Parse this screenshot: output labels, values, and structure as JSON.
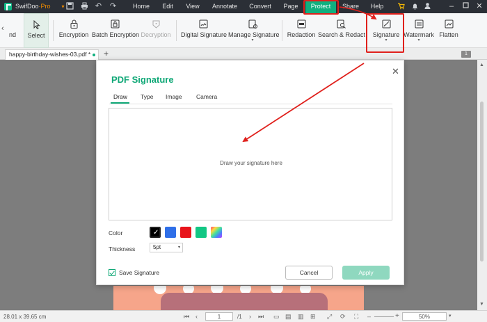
{
  "app": {
    "name": "SwifDoo",
    "edition": "·Pro",
    "brand_color": "#10b07f"
  },
  "menu": {
    "items": [
      {
        "label": "Home"
      },
      {
        "label": "Edit"
      },
      {
        "label": "View"
      },
      {
        "label": "Annotate"
      },
      {
        "label": "Convert"
      },
      {
        "label": "Page"
      },
      {
        "label": "Protect",
        "active": true
      },
      {
        "label": "Share"
      },
      {
        "label": "Help"
      }
    ]
  },
  "ribbon": {
    "partial_label": "nd",
    "buttons": [
      {
        "label": "Select",
        "icon": "cursor-icon"
      },
      {
        "label": "Encryption",
        "icon": "lock-icon"
      },
      {
        "label": "Batch Encryption",
        "icon": "batch-lock-icon"
      },
      {
        "label": "Decryption",
        "icon": "unlock-icon",
        "disabled": true
      },
      {
        "label": "Digital Signature",
        "icon": "digital-signature-icon"
      },
      {
        "label": "Manage Signature",
        "icon": "manage-signature-icon"
      },
      {
        "label": "Redaction",
        "icon": "redaction-icon"
      },
      {
        "label": "Search & Redact",
        "icon": "search-redact-icon"
      },
      {
        "label": "Signature",
        "icon": "signature-icon"
      },
      {
        "label": "Watermark",
        "icon": "watermark-icon"
      },
      {
        "label": "Flatten",
        "icon": "flatten-icon"
      }
    ]
  },
  "tabs": {
    "document": "happy-birthday-wishes-03.pdf *",
    "add": "+",
    "page_count_badge": "1"
  },
  "dialog": {
    "title": "PDF Signature",
    "tabs": [
      {
        "label": "Draw",
        "active": true
      },
      {
        "label": "Type"
      },
      {
        "label": "Image"
      },
      {
        "label": "Camera"
      }
    ],
    "placeholder": "Draw your signature here",
    "color_label": "Color",
    "colors": [
      "#000000",
      "#2f6fe8",
      "#e8141b",
      "#12c784",
      "multicolor"
    ],
    "selected_color": "#000000",
    "thickness_label": "Thickness",
    "thickness_value": "5pt",
    "save_signature_label": "Save Signature",
    "save_signature_checked": true,
    "cancel_label": "Cancel",
    "apply_label": "Apply"
  },
  "status": {
    "dimensions": "28.01 x 39.65 cm",
    "current_page": "1",
    "total_pages": "/1",
    "zoom": "50%"
  }
}
